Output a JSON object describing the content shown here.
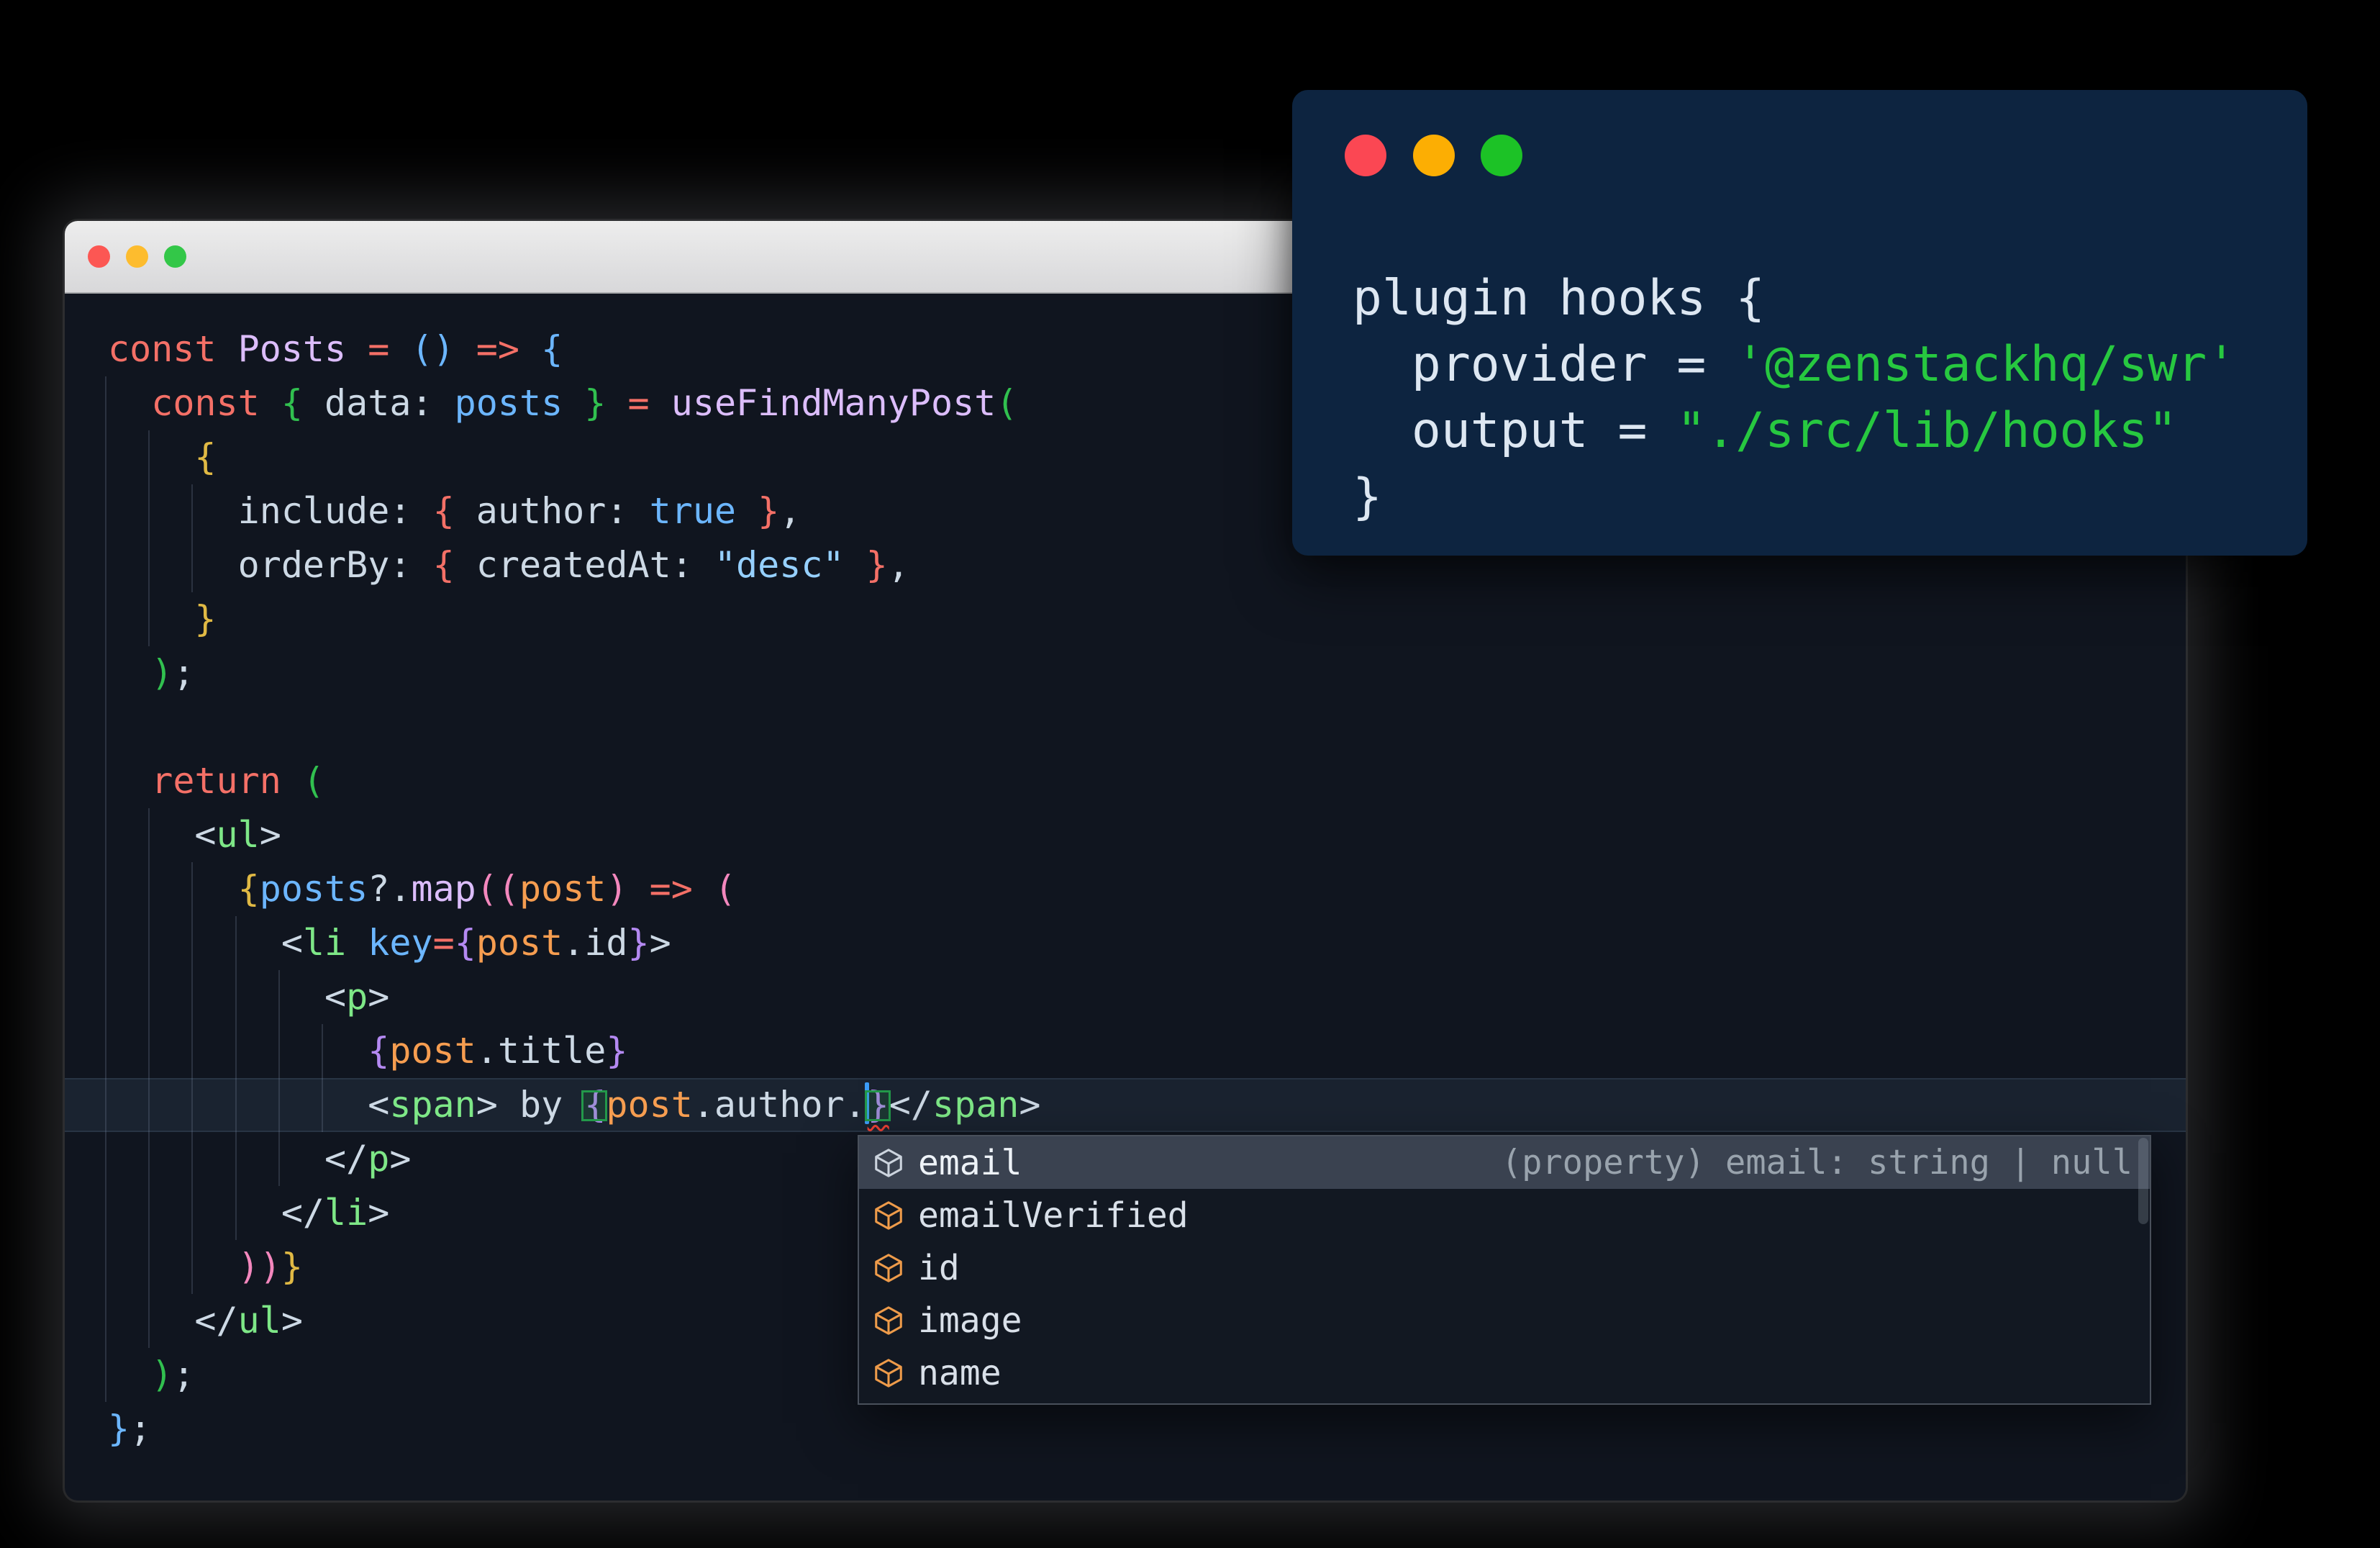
{
  "page": {
    "background": "#000000"
  },
  "palette": {
    "red": "#f47067",
    "purple": "#dcbdfb",
    "blue": "#6cb6ff",
    "string": "#96d0ff",
    "orange": "#f69d50",
    "tag": "#7ee787",
    "fg": "#cdd9e5",
    "gold": "#e0b944",
    "bgreen": "#31c04f",
    "pink": "#f387bd",
    "bpurple": "#b489f2",
    "bblue": "#6cb6ff"
  },
  "editor_window": {
    "titlebar_colors": {
      "top": "#ededed",
      "bottom": "#d8d8da",
      "border": "#a9abad"
    },
    "background": "#10151f",
    "traffic_lights": [
      {
        "name": "close-button",
        "color": "#fc5753"
      },
      {
        "name": "minimize-button",
        "color": "#fdbc2e"
      },
      {
        "name": "zoom-button",
        "color": "#33c748"
      }
    ],
    "code_lines": [
      {
        "tokens": [
          {
            "t": "const ",
            "c": "red"
          },
          {
            "t": "Posts",
            "c": "purple"
          },
          {
            "t": " ",
            "c": "fg"
          },
          {
            "t": "=",
            "c": "red"
          },
          {
            "t": " ",
            "c": "fg"
          },
          {
            "t": "()",
            "c": "bblue"
          },
          {
            "t": " ",
            "c": "fg"
          },
          {
            "t": "=>",
            "c": "red"
          },
          {
            "t": " ",
            "c": "fg"
          },
          {
            "t": "{",
            "c": "bblue"
          }
        ]
      },
      {
        "tokens": [
          {
            "t": "  ",
            "c": "fg"
          },
          {
            "t": "const ",
            "c": "red"
          },
          {
            "t": "{",
            "c": "bgreen"
          },
          {
            "t": " data: ",
            "c": "fg"
          },
          {
            "t": "posts",
            "c": "blue"
          },
          {
            "t": " ",
            "c": "fg"
          },
          {
            "t": "}",
            "c": "bgreen"
          },
          {
            "t": " ",
            "c": "fg"
          },
          {
            "t": "=",
            "c": "red"
          },
          {
            "t": " ",
            "c": "fg"
          },
          {
            "t": "useFindManyPost",
            "c": "purple"
          },
          {
            "t": "(",
            "c": "bgreen"
          }
        ]
      },
      {
        "tokens": [
          {
            "t": "    ",
            "c": "fg"
          },
          {
            "t": "{",
            "c": "gold"
          }
        ]
      },
      {
        "tokens": [
          {
            "t": "      ",
            "c": "fg"
          },
          {
            "t": "include: ",
            "c": "fg"
          },
          {
            "t": "{",
            "c": "red"
          },
          {
            "t": " author: ",
            "c": "fg"
          },
          {
            "t": "true",
            "c": "blue"
          },
          {
            "t": " ",
            "c": "fg"
          },
          {
            "t": "}",
            "c": "red"
          },
          {
            "t": ",",
            "c": "fg"
          }
        ]
      },
      {
        "tokens": [
          {
            "t": "      ",
            "c": "fg"
          },
          {
            "t": "orderBy: ",
            "c": "fg"
          },
          {
            "t": "{",
            "c": "red"
          },
          {
            "t": " createdAt: ",
            "c": "fg"
          },
          {
            "t": "\"desc\"",
            "c": "string"
          },
          {
            "t": " ",
            "c": "fg"
          },
          {
            "t": "}",
            "c": "red"
          },
          {
            "t": ",",
            "c": "fg"
          }
        ]
      },
      {
        "tokens": [
          {
            "t": "    ",
            "c": "fg"
          },
          {
            "t": "}",
            "c": "gold"
          }
        ]
      },
      {
        "tokens": [
          {
            "t": "  ",
            "c": "fg"
          },
          {
            "t": ")",
            "c": "bgreen"
          },
          {
            "t": ";",
            "c": "fg"
          }
        ]
      },
      {
        "tokens": []
      },
      {
        "tokens": [
          {
            "t": "  ",
            "c": "fg"
          },
          {
            "t": "return ",
            "c": "red"
          },
          {
            "t": "(",
            "c": "bgreen"
          }
        ]
      },
      {
        "tokens": [
          {
            "t": "    ",
            "c": "fg"
          },
          {
            "t": "<",
            "c": "fg"
          },
          {
            "t": "ul",
            "c": "tag"
          },
          {
            "t": ">",
            "c": "fg"
          }
        ]
      },
      {
        "tokens": [
          {
            "t": "      ",
            "c": "fg"
          },
          {
            "t": "{",
            "c": "gold"
          },
          {
            "t": "posts",
            "c": "blue"
          },
          {
            "t": "?.",
            "c": "fg"
          },
          {
            "t": "map",
            "c": "purple"
          },
          {
            "t": "(",
            "c": "pink"
          },
          {
            "t": "(",
            "c": "pink"
          },
          {
            "t": "post",
            "c": "orange"
          },
          {
            "t": ")",
            "c": "pink"
          },
          {
            "t": " ",
            "c": "fg"
          },
          {
            "t": "=>",
            "c": "red"
          },
          {
            "t": " ",
            "c": "fg"
          },
          {
            "t": "(",
            "c": "pink"
          }
        ]
      },
      {
        "tokens": [
          {
            "t": "        ",
            "c": "fg"
          },
          {
            "t": "<",
            "c": "fg"
          },
          {
            "t": "li",
            "c": "tag"
          },
          {
            "t": " ",
            "c": "fg"
          },
          {
            "t": "key",
            "c": "blue"
          },
          {
            "t": "=",
            "c": "red"
          },
          {
            "t": "{",
            "c": "bpurple"
          },
          {
            "t": "post",
            "c": "orange"
          },
          {
            "t": ".id",
            "c": "fg"
          },
          {
            "t": "}",
            "c": "bpurple"
          },
          {
            "t": ">",
            "c": "fg"
          }
        ]
      },
      {
        "tokens": [
          {
            "t": "          ",
            "c": "fg"
          },
          {
            "t": "<",
            "c": "fg"
          },
          {
            "t": "p",
            "c": "tag"
          },
          {
            "t": ">",
            "c": "fg"
          }
        ]
      },
      {
        "tokens": [
          {
            "t": "            ",
            "c": "fg"
          },
          {
            "t": "{",
            "c": "bpurple"
          },
          {
            "t": "post",
            "c": "orange"
          },
          {
            "t": ".title",
            "c": "fg"
          },
          {
            "t": "}",
            "c": "bpurple"
          }
        ]
      },
      {
        "active": true,
        "tokens": [
          {
            "t": "            ",
            "c": "fg"
          },
          {
            "t": "<",
            "c": "fg"
          },
          {
            "t": "span",
            "c": "tag"
          },
          {
            "t": ">",
            "c": "fg"
          },
          {
            "t": " by ",
            "c": "fg"
          },
          {
            "t": "{",
            "c": "bpurple",
            "f": "match"
          },
          {
            "t": "post",
            "c": "orange"
          },
          {
            "t": ".author.",
            "c": "fg"
          },
          {
            "cursor": true
          },
          {
            "t": "}",
            "c": "bpurple",
            "f": "match squiggle"
          },
          {
            "t": "</",
            "c": "fg"
          },
          {
            "t": "span",
            "c": "tag"
          },
          {
            "t": ">",
            "c": "fg"
          }
        ]
      },
      {
        "tokens": [
          {
            "t": "          ",
            "c": "fg"
          },
          {
            "t": "</",
            "c": "fg"
          },
          {
            "t": "p",
            "c": "tag"
          },
          {
            "t": ">",
            "c": "fg"
          }
        ]
      },
      {
        "tokens": [
          {
            "t": "        ",
            "c": "fg"
          },
          {
            "t": "</",
            "c": "fg"
          },
          {
            "t": "li",
            "c": "tag"
          },
          {
            "t": ">",
            "c": "fg"
          }
        ]
      },
      {
        "tokens": [
          {
            "t": "      ",
            "c": "fg"
          },
          {
            "t": "))",
            "c": "pink"
          },
          {
            "t": "}",
            "c": "gold"
          }
        ]
      },
      {
        "tokens": [
          {
            "t": "    ",
            "c": "fg"
          },
          {
            "t": "</",
            "c": "fg"
          },
          {
            "t": "ul",
            "c": "tag"
          },
          {
            "t": ">",
            "c": "fg"
          }
        ]
      },
      {
        "tokens": [
          {
            "t": "  ",
            "c": "fg"
          },
          {
            "t": ")",
            "c": "bgreen"
          },
          {
            "t": ";",
            "c": "fg"
          }
        ]
      },
      {
        "tokens": [
          {
            "t": "}",
            "c": "bblue"
          },
          {
            "t": ";",
            "c": "fg"
          }
        ]
      }
    ]
  },
  "overlay_window": {
    "background": "#0d2440",
    "text_color": "#dde7f2",
    "string_color": "#27c840",
    "traffic_lights": [
      {
        "name": "close-button",
        "color": "#fb4753"
      },
      {
        "name": "minimize-button",
        "color": "#fcae03"
      },
      {
        "name": "zoom-button",
        "color": "#1cc226"
      }
    ],
    "lines": [
      [
        {
          "t": "plugin hooks {",
          "c": "w"
        }
      ],
      [
        {
          "t": "  provider = ",
          "c": "w"
        },
        {
          "t": "'@zenstackhq/swr'",
          "c": "g"
        }
      ],
      [
        {
          "t": "  output = ",
          "c": "w"
        },
        {
          "t": "\"./src/lib/hooks\"",
          "c": "g"
        }
      ],
      [
        {
          "t": "}",
          "c": "w"
        }
      ]
    ]
  },
  "autocomplete": {
    "colors": {
      "bg": "#121822",
      "selected_bg": "#3a4250",
      "border": "#49505b",
      "label": "#d9e0e9",
      "label_selected": "#eef3f8",
      "detail": "#99a3ad",
      "icon": "#ee9b4a",
      "icon_selected": "#ccd4de"
    },
    "items": [
      {
        "label": "email",
        "icon": "field-cube-icon",
        "selected": true,
        "detail": "(property) email: string | null"
      },
      {
        "label": "emailVerified",
        "icon": "field-cube-icon"
      },
      {
        "label": "id",
        "icon": "field-cube-icon"
      },
      {
        "label": "image",
        "icon": "field-cube-icon"
      },
      {
        "label": "name",
        "icon": "field-cube-icon"
      }
    ]
  }
}
